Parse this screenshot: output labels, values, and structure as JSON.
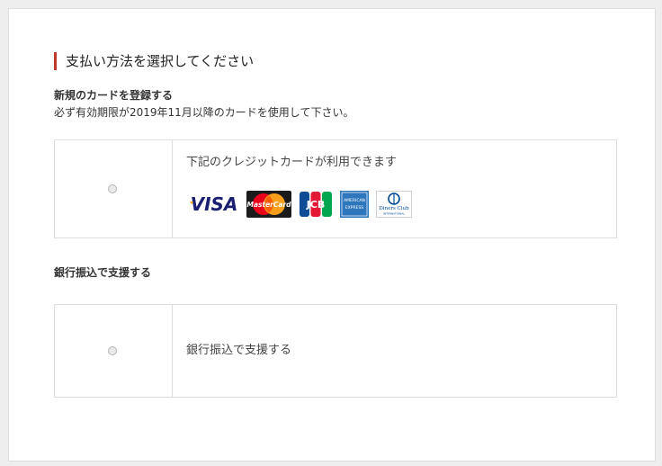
{
  "payment": {
    "title": "支払い方法を選択してください",
    "card": {
      "heading": "新規のカードを登録する",
      "note": "必ず有効期限が2019年11月以降のカードを使用して下さい。",
      "option_text": "下記のクレジットカードが利用できます",
      "brands": [
        "VISA",
        "MasterCard",
        "JCB",
        "AMERICAN EXPRESS",
        "Diners Club INTERNATIONAL"
      ]
    },
    "bank": {
      "heading": "銀行振込で支援する",
      "option_text": "銀行振込で支援する"
    }
  },
  "icons": [
    "radio-button",
    "visa-logo",
    "mastercard-logo",
    "jcb-logo",
    "amex-logo",
    "diners-club-logo"
  ],
  "colors": {
    "accent_bar": "#c0392b",
    "border": "#dddddd",
    "visa_blue": "#1a1f71",
    "visa_gold": "#f7a800",
    "mastercard_red": "#eb001b",
    "mastercard_orange": "#f79e1b",
    "amex_blue": "#2e77bc",
    "diners_blue": "#004a97"
  }
}
